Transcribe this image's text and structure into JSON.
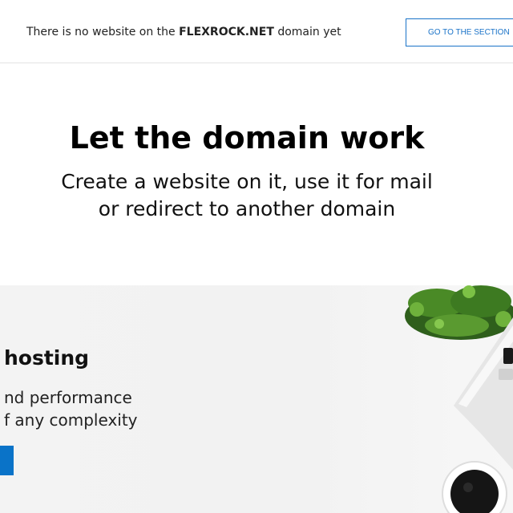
{
  "topbar": {
    "message_prefix": "There is no website on the",
    "domain": "FLEXROCK.NET",
    "message_suffix": "domain yet",
    "section_button_label": "GO TO THE SECTION"
  },
  "hero": {
    "title": "Let the domain work",
    "subtitle_line1": "Create a website on it, use it for mail",
    "subtitle_line2": "or redirect to another domain"
  },
  "hosting": {
    "title": "hosting",
    "line1": "nd performance",
    "line2": "f any complexity"
  },
  "colors": {
    "accent": "#1a73c8",
    "panel_bg": "#f2f2f2"
  },
  "icons": [
    "plant-image",
    "laptop-image",
    "coffee-cup-image"
  ]
}
